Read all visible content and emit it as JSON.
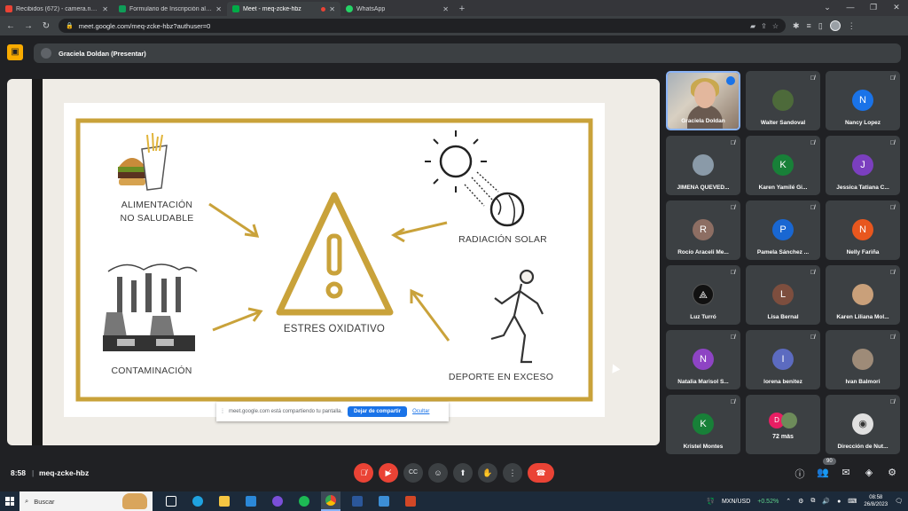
{
  "browser": {
    "tabs": [
      {
        "label": "Recibidos (672) - camera.nutricio",
        "color": "#ea4335"
      },
      {
        "label": "Formulario de Inscripción al \"Cu",
        "color": "#0f9d58"
      },
      {
        "label": "Meet - meq-zcke-hbz",
        "color": "#00ac47"
      },
      {
        "label": "WhatsApp",
        "color": "#25d366"
      }
    ],
    "url": "meet.google.com/meq-zcke-hbz?authuser=0"
  },
  "meet": {
    "presenter": "Graciela Doldan (Presentar)",
    "clock": "8:58",
    "code": "meq-zcke-hbz",
    "participant_count": "90"
  },
  "slide": {
    "center": "ESTRES OXIDATIVO",
    "food_line1": "ALIMENTACIÓN",
    "food_line2": "NO SALUDABLE",
    "solar": "RADIACIÓN SOLAR",
    "pollution": "CONTAMINACIÓN",
    "sport": "DEPORTE EN EXCESO",
    "accent_color": "#c9a23a"
  },
  "share_bar": {
    "message": "meet.google.com está compartiendo tu pantalla.",
    "stop": "Dejar de compartir",
    "hide": "Ocultar"
  },
  "participants": [
    {
      "name": "Graciela Doldan",
      "type": "photo"
    },
    {
      "name": "Walter Sandoval",
      "type": "avatar-img",
      "color": "#4d6a3a"
    },
    {
      "name": "Nancy Lopez",
      "initial": "N",
      "color": "#1a73e8"
    },
    {
      "name": "JIMENA QUEVED...",
      "type": "avatar-img",
      "color": "#8a9aa8"
    },
    {
      "name": "Karen Yamilé Gi...",
      "initial": "K",
      "color": "#188038"
    },
    {
      "name": "Jessica Tatiana C...",
      "initial": "J",
      "color": "#7b3fbf"
    },
    {
      "name": "Rocío Araceli Me...",
      "initial": "R",
      "color": "#8d6e63"
    },
    {
      "name": "Pamela Sánchez ...",
      "initial": "P",
      "color": "#1967d2"
    },
    {
      "name": "Nelly Fariña",
      "initial": "N",
      "color": "#e8571e"
    },
    {
      "name": "Luz Turró",
      "type": "avatar-img",
      "color": "#111111"
    },
    {
      "name": "Lisa Bernal",
      "initial": "L",
      "color": "#7d4e3e"
    },
    {
      "name": "Karen Liliana Mol...",
      "type": "avatar-img",
      "color": "#c9a07a"
    },
    {
      "name": "Natalia Marisol S...",
      "initial": "N",
      "color": "#8e44c4"
    },
    {
      "name": "lorena benitez",
      "initial": "I",
      "color": "#5c6bc0"
    },
    {
      "name": "Ivan Balmori",
      "type": "avatar-img",
      "color": "#9e8b78"
    },
    {
      "name": "Kristel Montes",
      "initial": "K",
      "color": "#188038"
    },
    {
      "name": "72 más",
      "type": "more"
    },
    {
      "name": "Dirección de Nut...",
      "type": "avatar-img",
      "color": "#e0e0e0"
    }
  ],
  "taskbar": {
    "search": "Buscar",
    "ticker": "MXN/USD",
    "ticker_change": "+0.52%",
    "time": "08:58",
    "date": "26/8/2023"
  }
}
